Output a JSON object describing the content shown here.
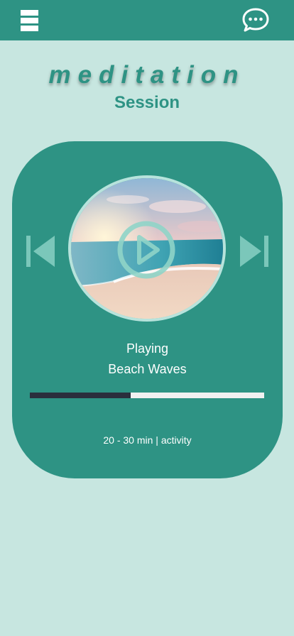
{
  "header": {
    "menu_icon": "hamburger-menu-icon",
    "chat_icon": "chat-bubble-icon"
  },
  "page": {
    "title": "meditation",
    "subtitle": "Session"
  },
  "player": {
    "status": "Playing",
    "track": "Beach Waves",
    "progress": 0.43,
    "duration": "20 - 30 min | activity",
    "artwork": "beach-sunset-image",
    "play_icon": "play-icon",
    "prev_icon": "skip-previous-icon",
    "next_icon": "skip-next-icon"
  },
  "colors": {
    "background": "#c7e6e0",
    "brand": "#2e9384",
    "progress_track": "#f1f1f1",
    "progress_fill": "#2a2f3d"
  }
}
